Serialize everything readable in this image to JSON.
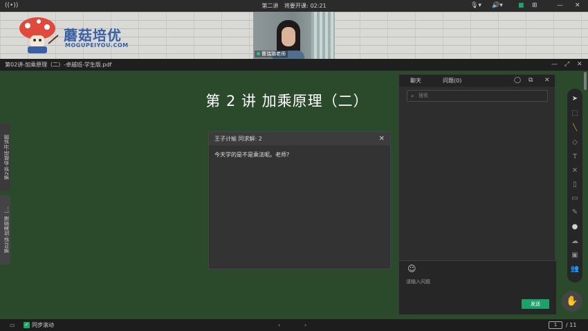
{
  "topbar": {
    "lesson": "第二讲",
    "countdown_label": "将要开课:",
    "countdown": "02:21"
  },
  "banner": {
    "brand": "蘑菇培优",
    "brand_sub": "MOGUPEIYOU.COM",
    "teacher_name": "曹瑞璐老师"
  },
  "doc": {
    "filename": "第02讲-加乘原理（二）-卓越班-学生版.pdf"
  },
  "slide": {
    "title": "第 2 讲  加乘原理（二）",
    "tab_top": "第2讲-卓越班-开讲题",
    "tab_bottom": "第02讲-加乘原理（..."
  },
  "popup": {
    "header": "王子计瑜  同求解: 2",
    "message": "今天学的是不是乘法呢。老师?"
  },
  "chat": {
    "tab_chat": "聊天",
    "tab_questions": "问题(0)",
    "search_placeholder": "搜索",
    "input_placeholder": "请输入问题",
    "send_label": "发送"
  },
  "bottom": {
    "sync_label": "同步滚动",
    "page_current": "1",
    "page_total": "/ 11"
  },
  "colors": {
    "board": "#2b4a2b",
    "accent": "#1da06a",
    "brand": "#3a5fa6"
  }
}
